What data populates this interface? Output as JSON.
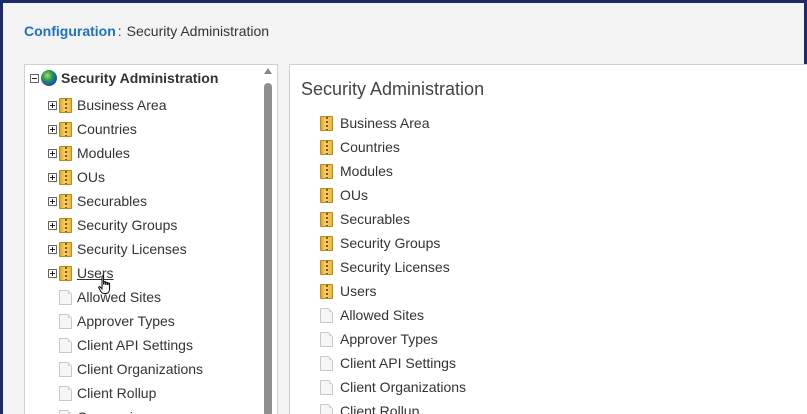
{
  "breadcrumb": {
    "parent": "Configuration",
    "separator": ":",
    "current": "Security Administration"
  },
  "tree": {
    "root_label": "Security Administration",
    "items": [
      {
        "label": "Business Area",
        "type": "folder",
        "expandable": true
      },
      {
        "label": "Countries",
        "type": "folder",
        "expandable": true
      },
      {
        "label": "Modules",
        "type": "folder",
        "expandable": true
      },
      {
        "label": "OUs",
        "type": "folder",
        "expandable": true
      },
      {
        "label": "Securables",
        "type": "folder",
        "expandable": true
      },
      {
        "label": "Security Groups",
        "type": "folder",
        "expandable": true
      },
      {
        "label": "Security Licenses",
        "type": "folder",
        "expandable": true
      },
      {
        "label": "Users",
        "type": "folder",
        "expandable": true
      },
      {
        "label": "Allowed Sites",
        "type": "document",
        "expandable": false
      },
      {
        "label": "Approver Types",
        "type": "document",
        "expandable": false
      },
      {
        "label": "Client API Settings",
        "type": "document",
        "expandable": false
      },
      {
        "label": "Client Organizations",
        "type": "document",
        "expandable": false
      },
      {
        "label": "Client Rollup",
        "type": "document",
        "expandable": false
      },
      {
        "label": "Companies",
        "type": "document",
        "expandable": false
      }
    ]
  },
  "content": {
    "title": "Security Administration",
    "items": [
      {
        "label": "Business Area",
        "type": "folder"
      },
      {
        "label": "Countries",
        "type": "folder"
      },
      {
        "label": "Modules",
        "type": "folder"
      },
      {
        "label": "OUs",
        "type": "folder"
      },
      {
        "label": "Securables",
        "type": "folder"
      },
      {
        "label": "Security Groups",
        "type": "folder"
      },
      {
        "label": "Security Licenses",
        "type": "folder"
      },
      {
        "label": "Users",
        "type": "folder"
      },
      {
        "label": "Allowed Sites",
        "type": "document"
      },
      {
        "label": "Approver Types",
        "type": "document"
      },
      {
        "label": "Client API Settings",
        "type": "document"
      },
      {
        "label": "Client Organizations",
        "type": "document"
      },
      {
        "label": "Client Rollup",
        "type": "document"
      }
    ]
  },
  "colors": {
    "frame": "#1b2a6b",
    "link": "#1d72c2",
    "folder": "#e8b640"
  },
  "icons": {
    "root": "globe-icon",
    "folder": "folder-icon",
    "document": "document-icon",
    "cursor": "hand-cursor-icon"
  }
}
